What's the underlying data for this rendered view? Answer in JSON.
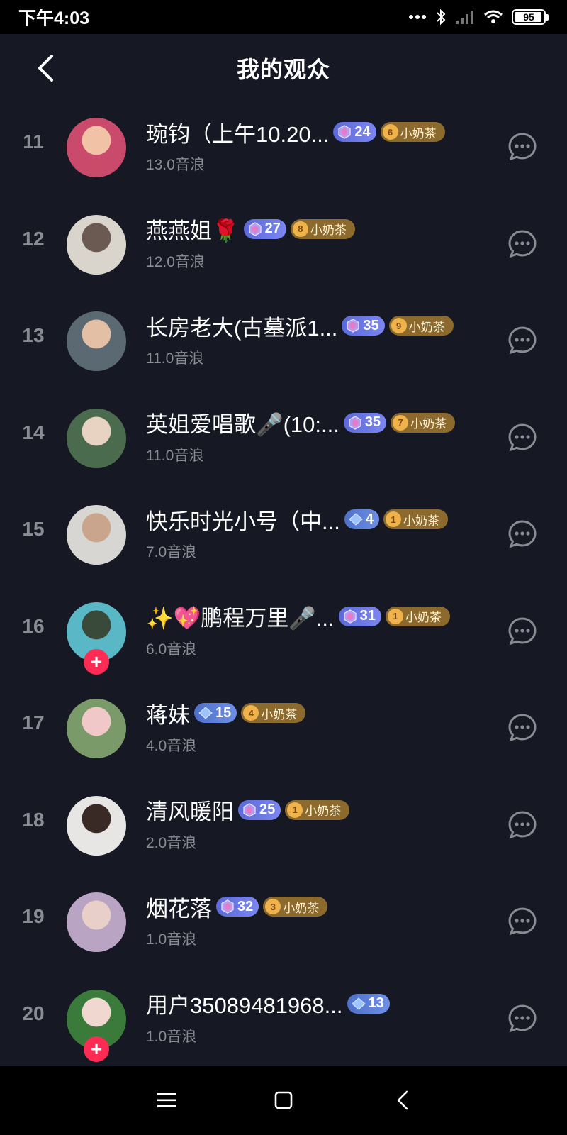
{
  "status_bar": {
    "time": "下午4:03",
    "battery": "95",
    "battery_level_percent": 95
  },
  "header": {
    "title": "我的观众",
    "back_icon": "chevron-left-icon"
  },
  "colors": {
    "background": "#161823",
    "plus_button": "#fe2c55",
    "fan_badge": "#8c6a2e",
    "muted_text": "#8a8b93"
  },
  "audience": [
    {
      "rank": "11",
      "name": "琬钧（上午10.20...",
      "level": "24",
      "level_style": "purple",
      "fan_level": "6",
      "fan_label": "小奶茶",
      "score": "13.0音浪",
      "followable": false
    },
    {
      "rank": "12",
      "name": "燕燕姐🌹",
      "level": "27",
      "level_style": "purple",
      "fan_level": "8",
      "fan_label": "小奶茶",
      "score": "12.0音浪",
      "followable": false
    },
    {
      "rank": "13",
      "name": "长房老大(古墓派1...",
      "level": "35",
      "level_style": "purple",
      "fan_level": "9",
      "fan_label": "小奶茶",
      "score": "11.0音浪",
      "followable": false
    },
    {
      "rank": "14",
      "name": "英姐爱唱歌🎤(10:...",
      "level": "35",
      "level_style": "purple",
      "fan_level": "7",
      "fan_label": "小奶茶",
      "score": "11.0音浪",
      "followable": false
    },
    {
      "rank": "15",
      "name": "快乐时光小号（中...",
      "level": "4",
      "level_style": "blue",
      "fan_level": "1",
      "fan_label": "小奶茶",
      "score": "7.0音浪",
      "followable": false
    },
    {
      "rank": "16",
      "name": "✨💖鹏程万里🎤...",
      "level": "31",
      "level_style": "purple",
      "fan_level": "1",
      "fan_label": "小奶茶",
      "score": "6.0音浪",
      "followable": true
    },
    {
      "rank": "17",
      "name": "蒋妹",
      "level": "15",
      "level_style": "blue",
      "fan_level": "4",
      "fan_label": "小奶茶",
      "score": "4.0音浪",
      "followable": false
    },
    {
      "rank": "18",
      "name": "清风暖阳",
      "level": "25",
      "level_style": "purple",
      "fan_level": "1",
      "fan_label": "小奶茶",
      "score": "2.0音浪",
      "followable": false
    },
    {
      "rank": "19",
      "name": "烟花落",
      "level": "32",
      "level_style": "purple",
      "fan_level": "3",
      "fan_label": "小奶茶",
      "score": "1.0音浪",
      "followable": false
    },
    {
      "rank": "20",
      "name": "用户35089481968...",
      "level": "13",
      "level_style": "blue",
      "fan_level": "",
      "fan_label": "",
      "score": "1.0音浪",
      "followable": true
    }
  ],
  "icons": {
    "message": "chat-bubble-icon",
    "follow": "plus-icon",
    "avatar": "avatar-photo"
  },
  "nav_bar": {
    "menu_icon": "menu-icon",
    "home_icon": "home-square-icon",
    "back_icon": "back-triangle-icon"
  }
}
